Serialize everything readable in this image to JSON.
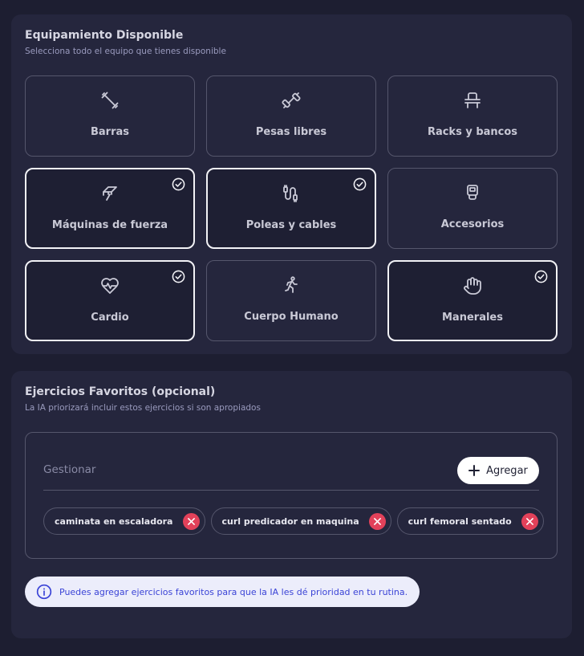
{
  "equipment": {
    "title": "Equipamiento Disponible",
    "subtitle": "Selecciona todo el equipo que tienes disponible",
    "items": [
      {
        "label": "Barras",
        "icon": "barbell-icon",
        "selected": false
      },
      {
        "label": "Pesas libres",
        "icon": "dumbbell-icon",
        "selected": false
      },
      {
        "label": "Racks y bancos",
        "icon": "bench-icon",
        "selected": false
      },
      {
        "label": "Máquinas de fuerza",
        "icon": "machine-icon",
        "selected": true
      },
      {
        "label": "Poleas y cables",
        "icon": "cable-icon",
        "selected": true
      },
      {
        "label": "Accesorios",
        "icon": "accessory-icon",
        "selected": false
      },
      {
        "label": "Cardio",
        "icon": "heart-pulse-icon",
        "selected": true
      },
      {
        "label": "Cuerpo Humano",
        "icon": "running-person-icon",
        "selected": false
      },
      {
        "label": "Manerales",
        "icon": "hand-icon",
        "selected": true
      }
    ]
  },
  "favorites": {
    "title": "Ejercicios Favoritos (opcional)",
    "subtitle": "La IA priorizará incluir estos ejercicios si son apropiados",
    "manage_label": "Gestionar",
    "add_label": "Agregar",
    "chips": [
      {
        "label": "caminata en escaladora"
      },
      {
        "label": "curl predicador en maquina"
      },
      {
        "label": "curl femoral sentado"
      }
    ],
    "info_text": "Puedes agregar ejercicios favoritos para que la IA les dé prioridad en tu rutina."
  },
  "colors": {
    "background": "#1d1e31",
    "panel": "#25263d",
    "remove": "#e2415a",
    "info_bg": "#ecedfb",
    "info_text": "#3a43d6"
  }
}
